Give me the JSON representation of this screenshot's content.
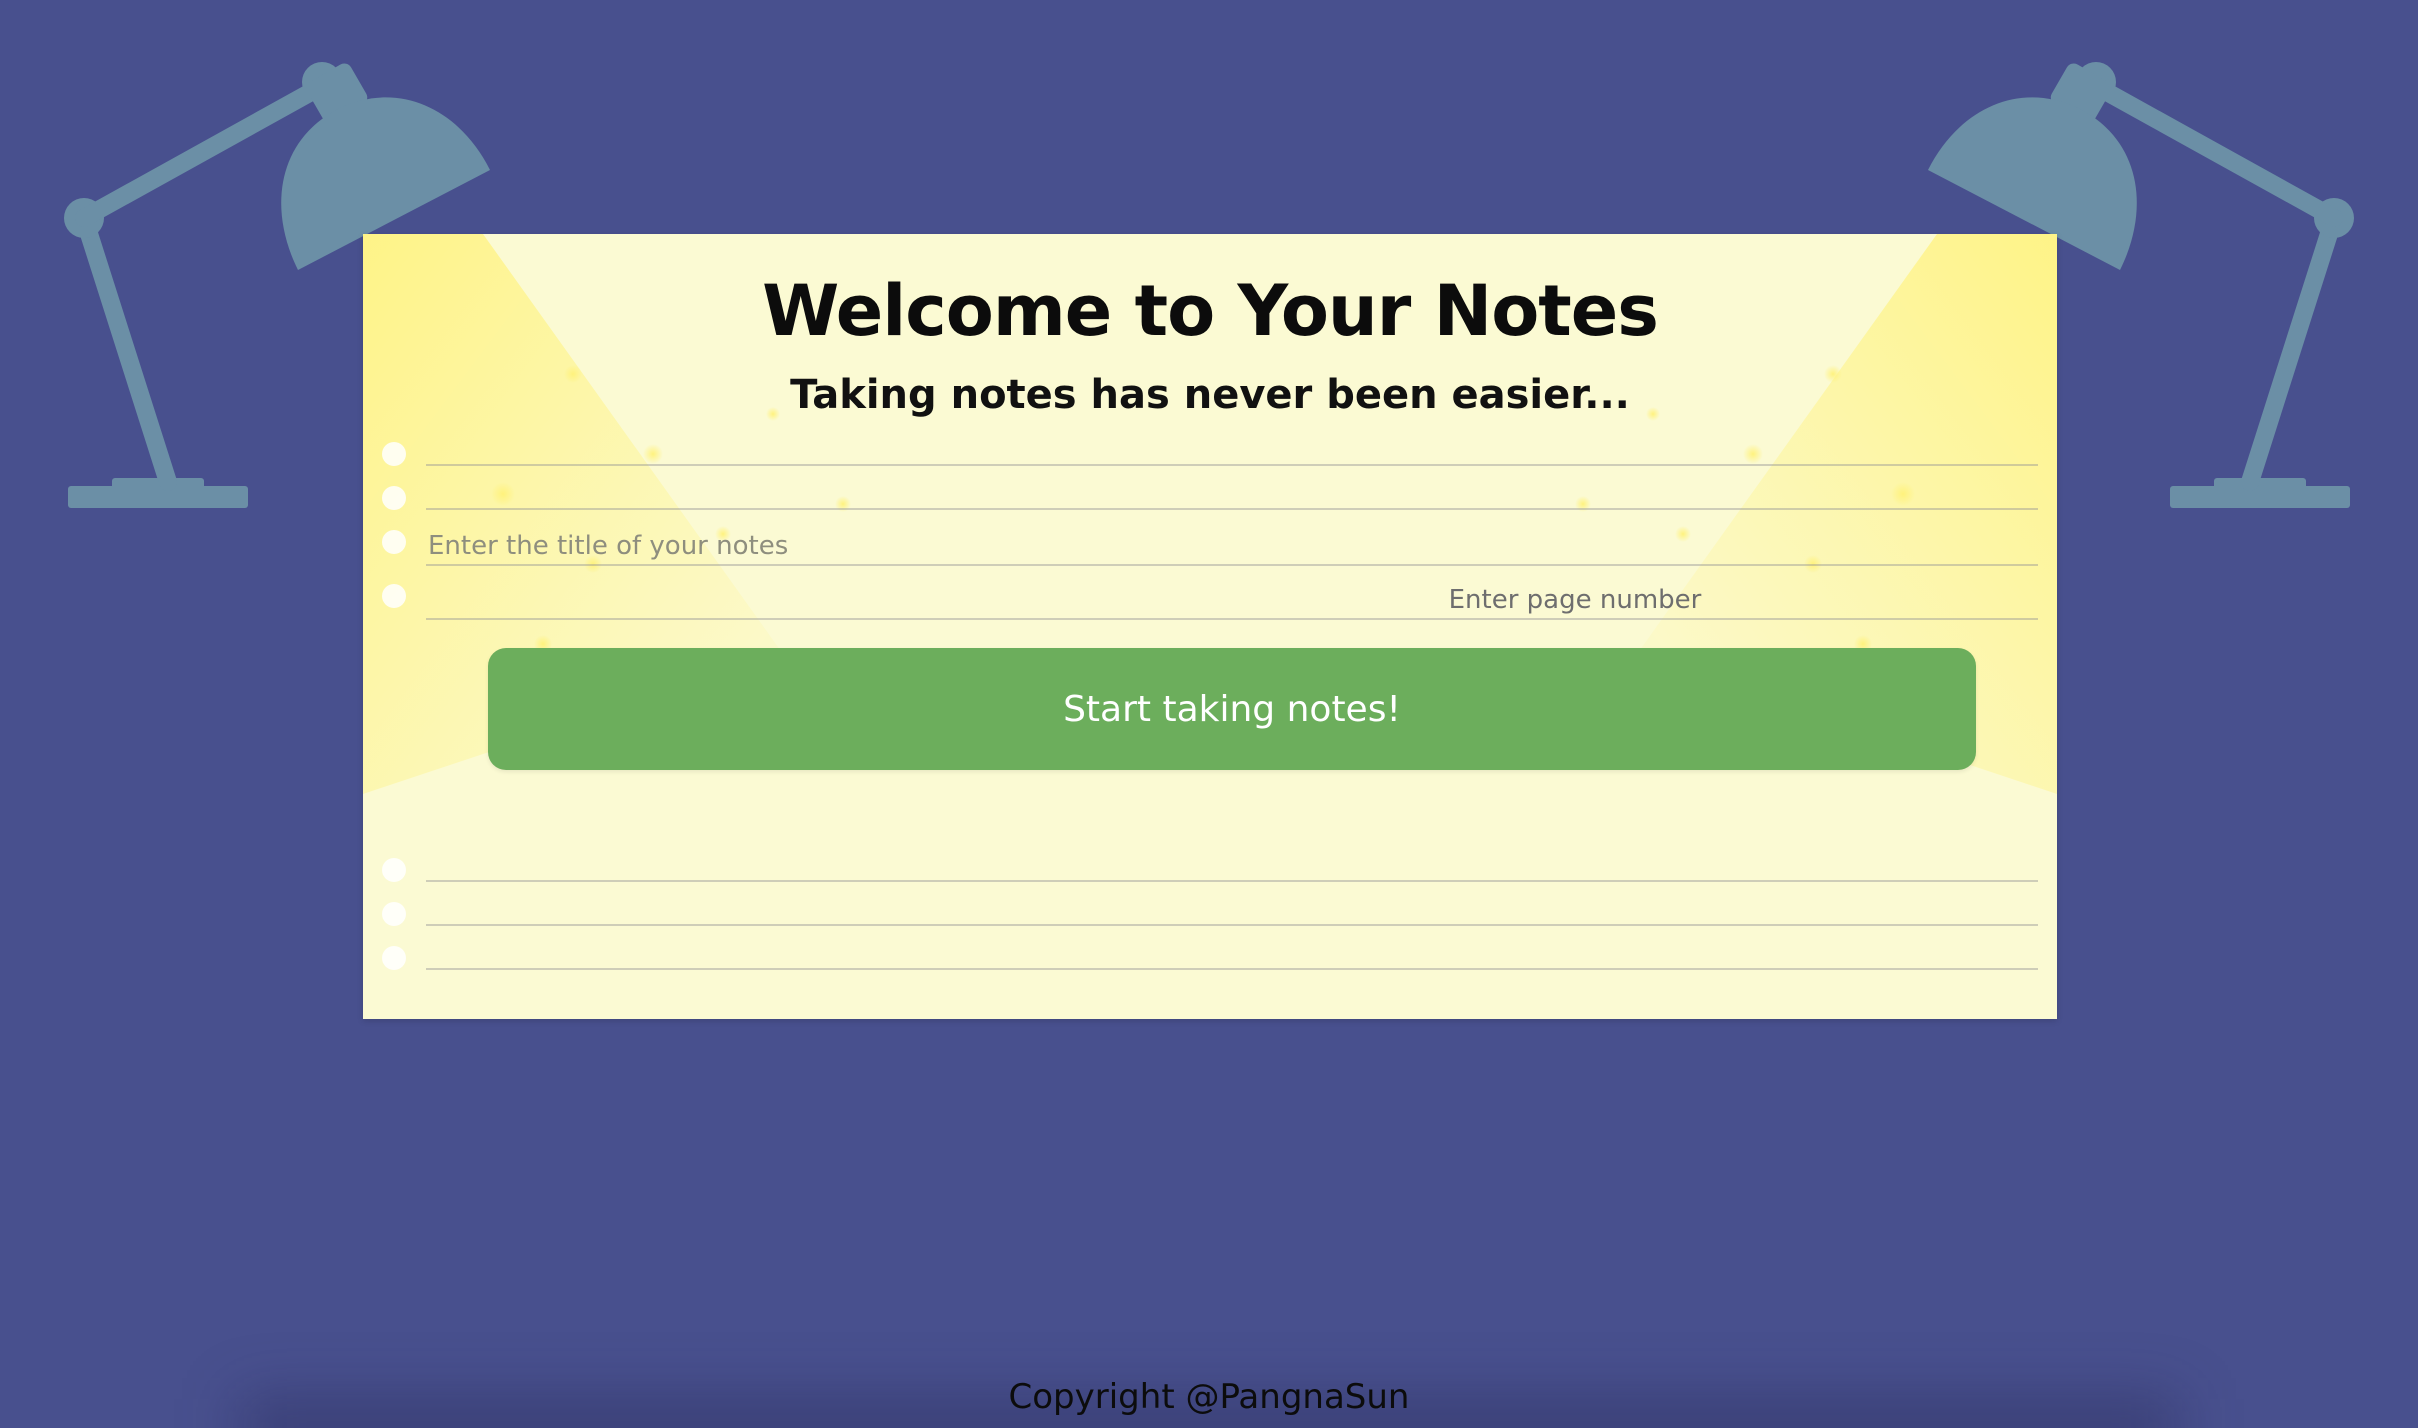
{
  "page": {
    "title": "Welcome to Your Notes",
    "subtitle": "Taking notes has never been easier...",
    "footer": "Copyright @PangnaSun"
  },
  "form": {
    "title_placeholder": "Enter the title of your notes",
    "page_placeholder": "Enter page number",
    "submit_label": "Start taking notes!"
  },
  "decor": {
    "left_lamp_icon": "desk-lamp-icon",
    "right_lamp_icon": "desk-lamp-icon"
  },
  "colors": {
    "background": "#48508e",
    "paper": "#fbfad3",
    "button": "#6cae5c",
    "lamp": "#6b8fa6",
    "light_beam": "#fff176"
  }
}
